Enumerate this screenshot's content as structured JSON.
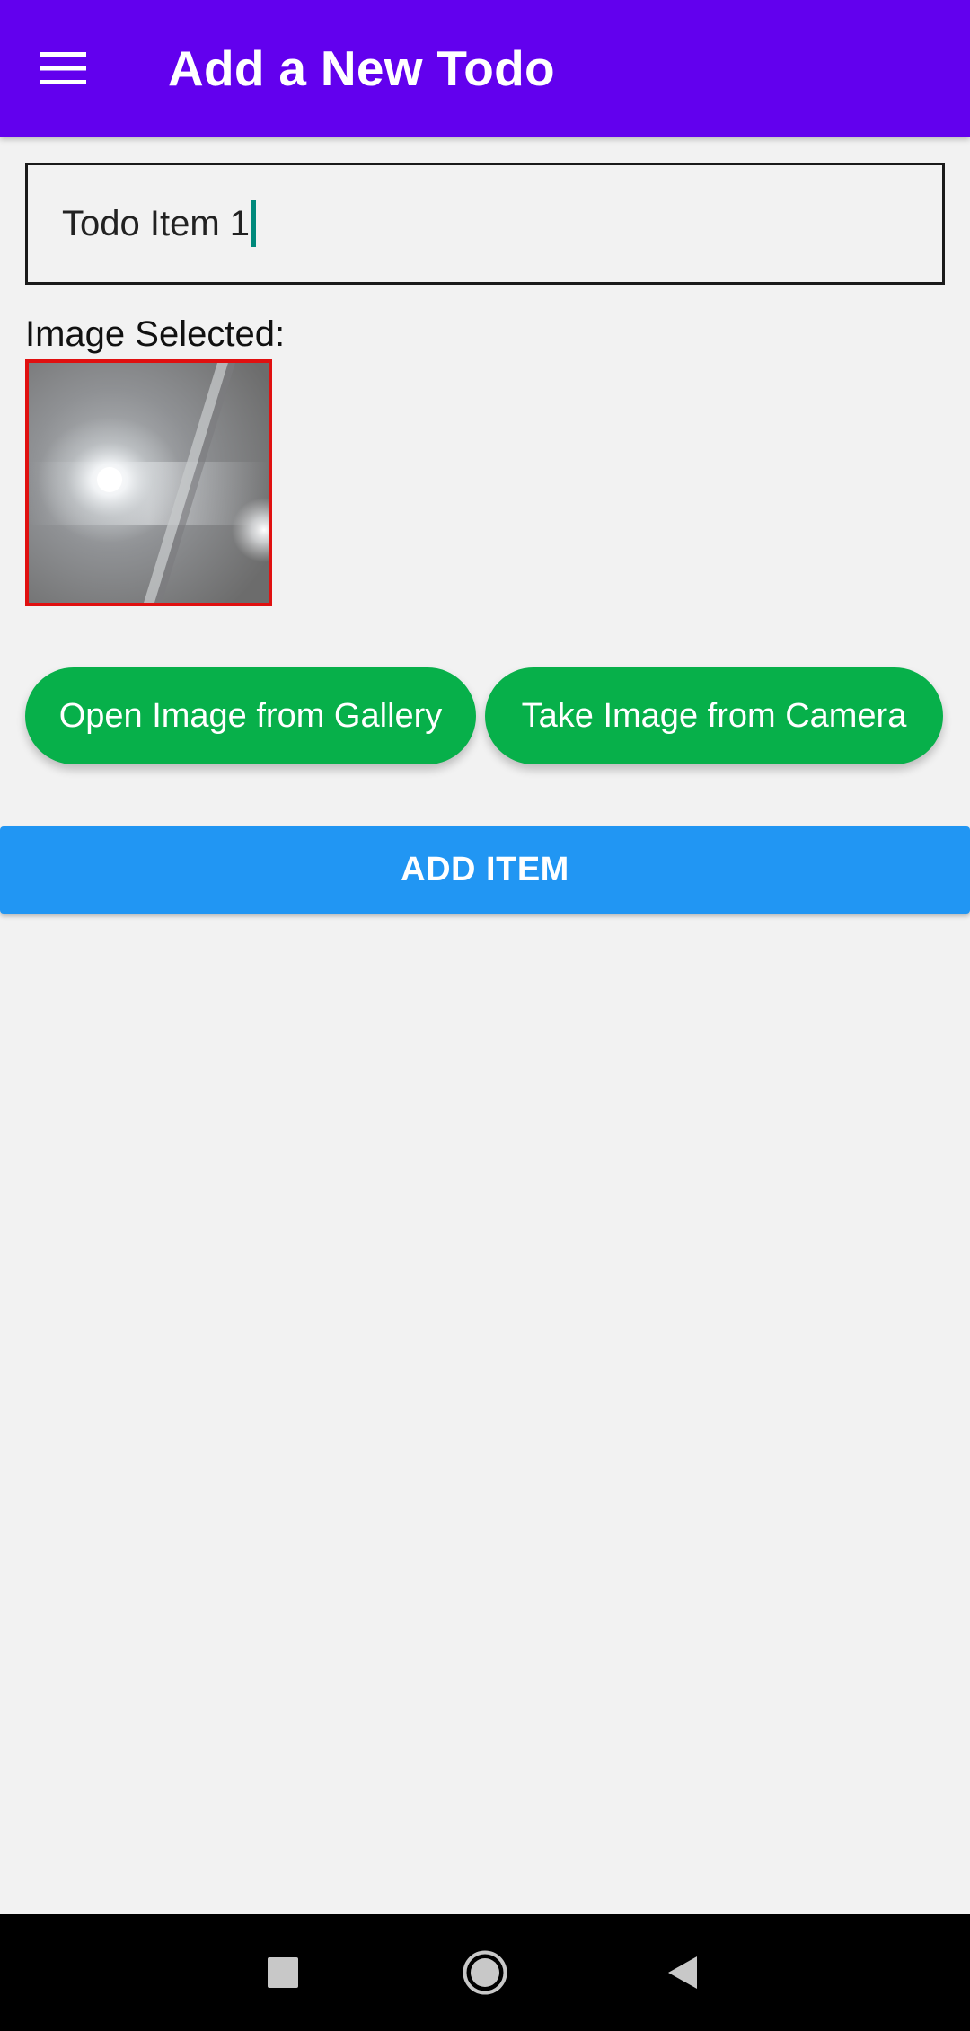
{
  "app_bar": {
    "title": "Add a New Todo",
    "menu_icon": "hamburger-menu-icon",
    "background": "#6200ee"
  },
  "form": {
    "todo_input_value": "Todo Item 1",
    "image_label": "Image Selected:",
    "image_border_color": "#e01010"
  },
  "buttons": {
    "gallery_label": "Open Image from Gallery",
    "camera_label": "Take Image from Camera",
    "add_label": "ADD ITEM",
    "pill_color": "#07b04a",
    "add_color": "#2196f3"
  },
  "nav_bar": {
    "recents_icon": "square-recents-icon",
    "home_icon": "circle-home-icon",
    "back_icon": "triangle-back-icon"
  }
}
